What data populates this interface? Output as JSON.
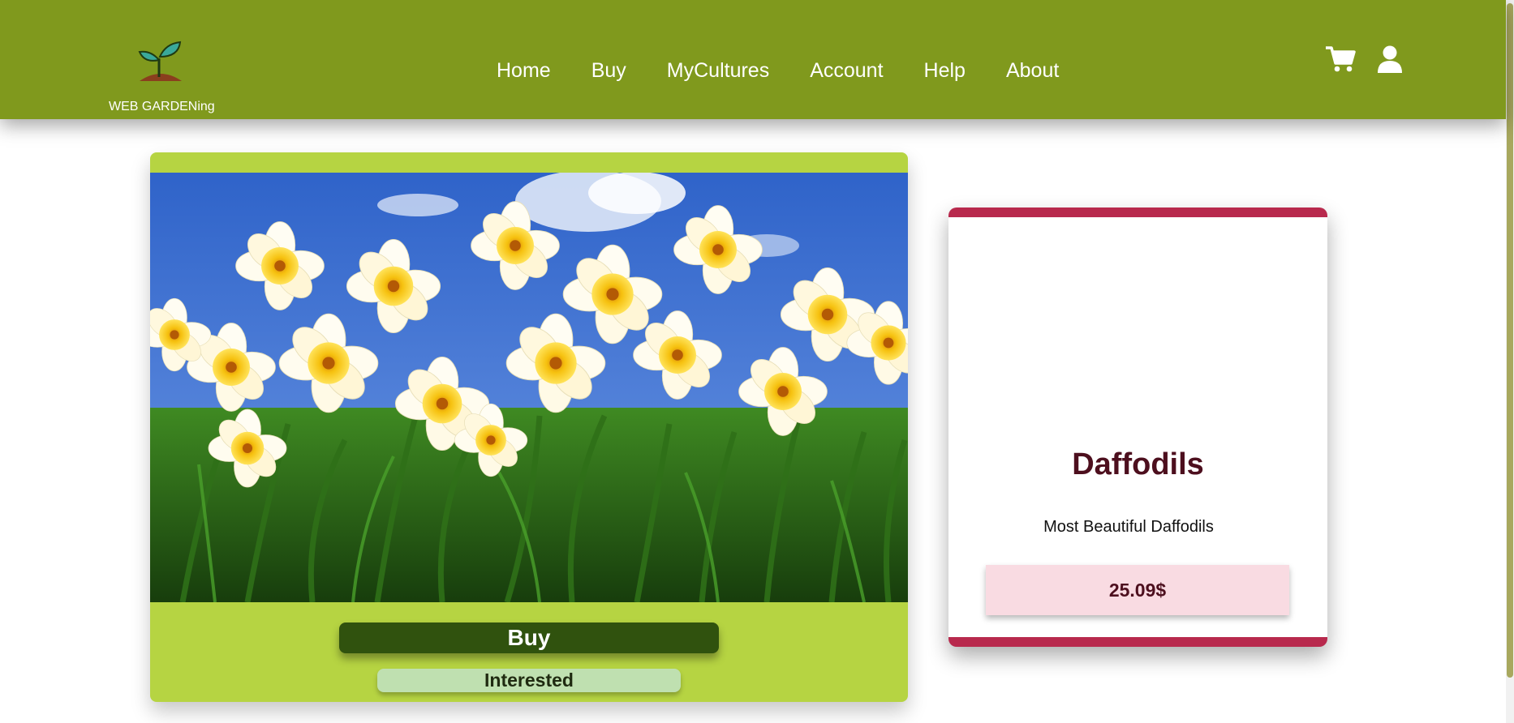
{
  "header": {
    "brand": "WEB GARDENing",
    "nav": [
      {
        "label": "Home"
      },
      {
        "label": "Buy"
      },
      {
        "label": "MyCultures"
      },
      {
        "label": "Account"
      },
      {
        "label": "Help"
      },
      {
        "label": "About"
      }
    ],
    "icons": [
      "sprout-logo-icon",
      "cart-icon",
      "user-icon"
    ]
  },
  "product": {
    "name": "Daffodils",
    "description": "Most Beautiful Daffodils",
    "price": "25.09$",
    "image": "daffodils-photo",
    "buy_label": "Buy",
    "interested_label": "Interested"
  },
  "colors": {
    "header_bg": "#80991d",
    "image_card_bg": "#b6d442",
    "buy_button_bg": "#30520e",
    "interested_button_bg": "#bfe0b0",
    "info_card_accent": "#b8294d",
    "product_text": "#4d0f1e",
    "price_bg": "#f9dbe2"
  }
}
